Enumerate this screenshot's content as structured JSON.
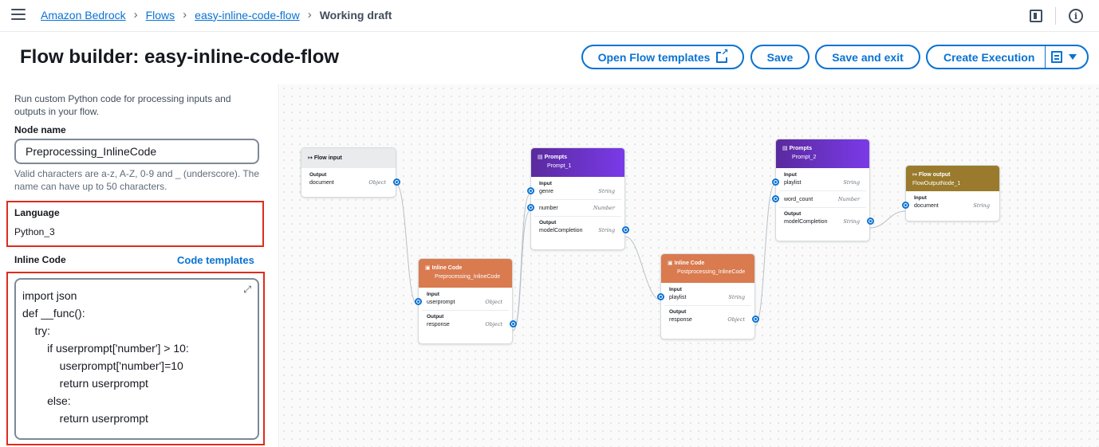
{
  "breadcrumb": {
    "items": [
      "Amazon Bedrock",
      "Flows",
      "easy-inline-code-flow"
    ],
    "current": "Working draft"
  },
  "header": {
    "title": "Flow builder: easy-inline-code-flow",
    "open_templates": "Open Flow templates",
    "save": "Save",
    "save_exit": "Save and exit",
    "create_execution": "Create Execution"
  },
  "panel": {
    "description": "Run custom Python code for processing inputs and outputs in your flow.",
    "node_name_label": "Node name",
    "node_name_value": "Preprocessing_InlineCode",
    "node_name_hint": "Valid characters are a-z, A-Z, 0-9 and _ (underscore). The name can have up to 50 characters.",
    "language_label": "Language",
    "language_value": "Python_3",
    "inline_code_label": "Inline Code",
    "code_templates": "Code templates",
    "code_lines": [
      "import json",
      "def __func():",
      "    try:",
      "        if userprompt['number'] > 10:",
      "            userprompt['number']=10",
      "            return userprompt",
      "        else:",
      "            return userprompt"
    ]
  },
  "flow": {
    "flow_input": {
      "title": "Flow input",
      "output_label": "Output",
      "out_name": "document",
      "out_type": "Object"
    },
    "prompt1": {
      "title": "Prompts",
      "name": "Prompt_1",
      "input_label": "Input",
      "in1": "genre",
      "in1_type": "String",
      "in2": "number",
      "in2_type": "Number",
      "output_label": "Output",
      "out": "modelCompletion",
      "out_type": "String"
    },
    "code1": {
      "title": "Inline Code",
      "name": "Preprocessing_InlineCode",
      "input_label": "Input",
      "in1": "userprompt",
      "in1_type": "Object",
      "output_label": "Output",
      "out": "response",
      "out_type": "Object"
    },
    "code2": {
      "title": "Inline Code",
      "name": "Postprocessing_InlineCode",
      "input_label": "Input",
      "in1": "playlist",
      "in1_type": "String",
      "output_label": "Output",
      "out": "response",
      "out_type": "Object"
    },
    "prompt2": {
      "title": "Prompts",
      "name": "Prompt_2",
      "input_label": "Input",
      "in1": "playlist",
      "in1_type": "String",
      "in2": "word_count",
      "in2_type": "Number",
      "output_label": "Output",
      "out": "modelCompletion",
      "out_type": "String"
    },
    "flow_output": {
      "title": "Flow output",
      "name": "FlowOutputNode_1",
      "input_label": "Input",
      "in1": "document",
      "in1_type": "String"
    }
  },
  "icons": {
    "menu": "menu-icon",
    "panel": "panel-icon",
    "info": "info-icon",
    "external": "external-link-icon",
    "expand": "expand-icon"
  },
  "colors": {
    "link": "#0972d3",
    "highlight": "#e02b1c",
    "prompt_node": "#7a3ae8",
    "code_node": "#d97a4f",
    "output_node": "#9a7a2c"
  }
}
